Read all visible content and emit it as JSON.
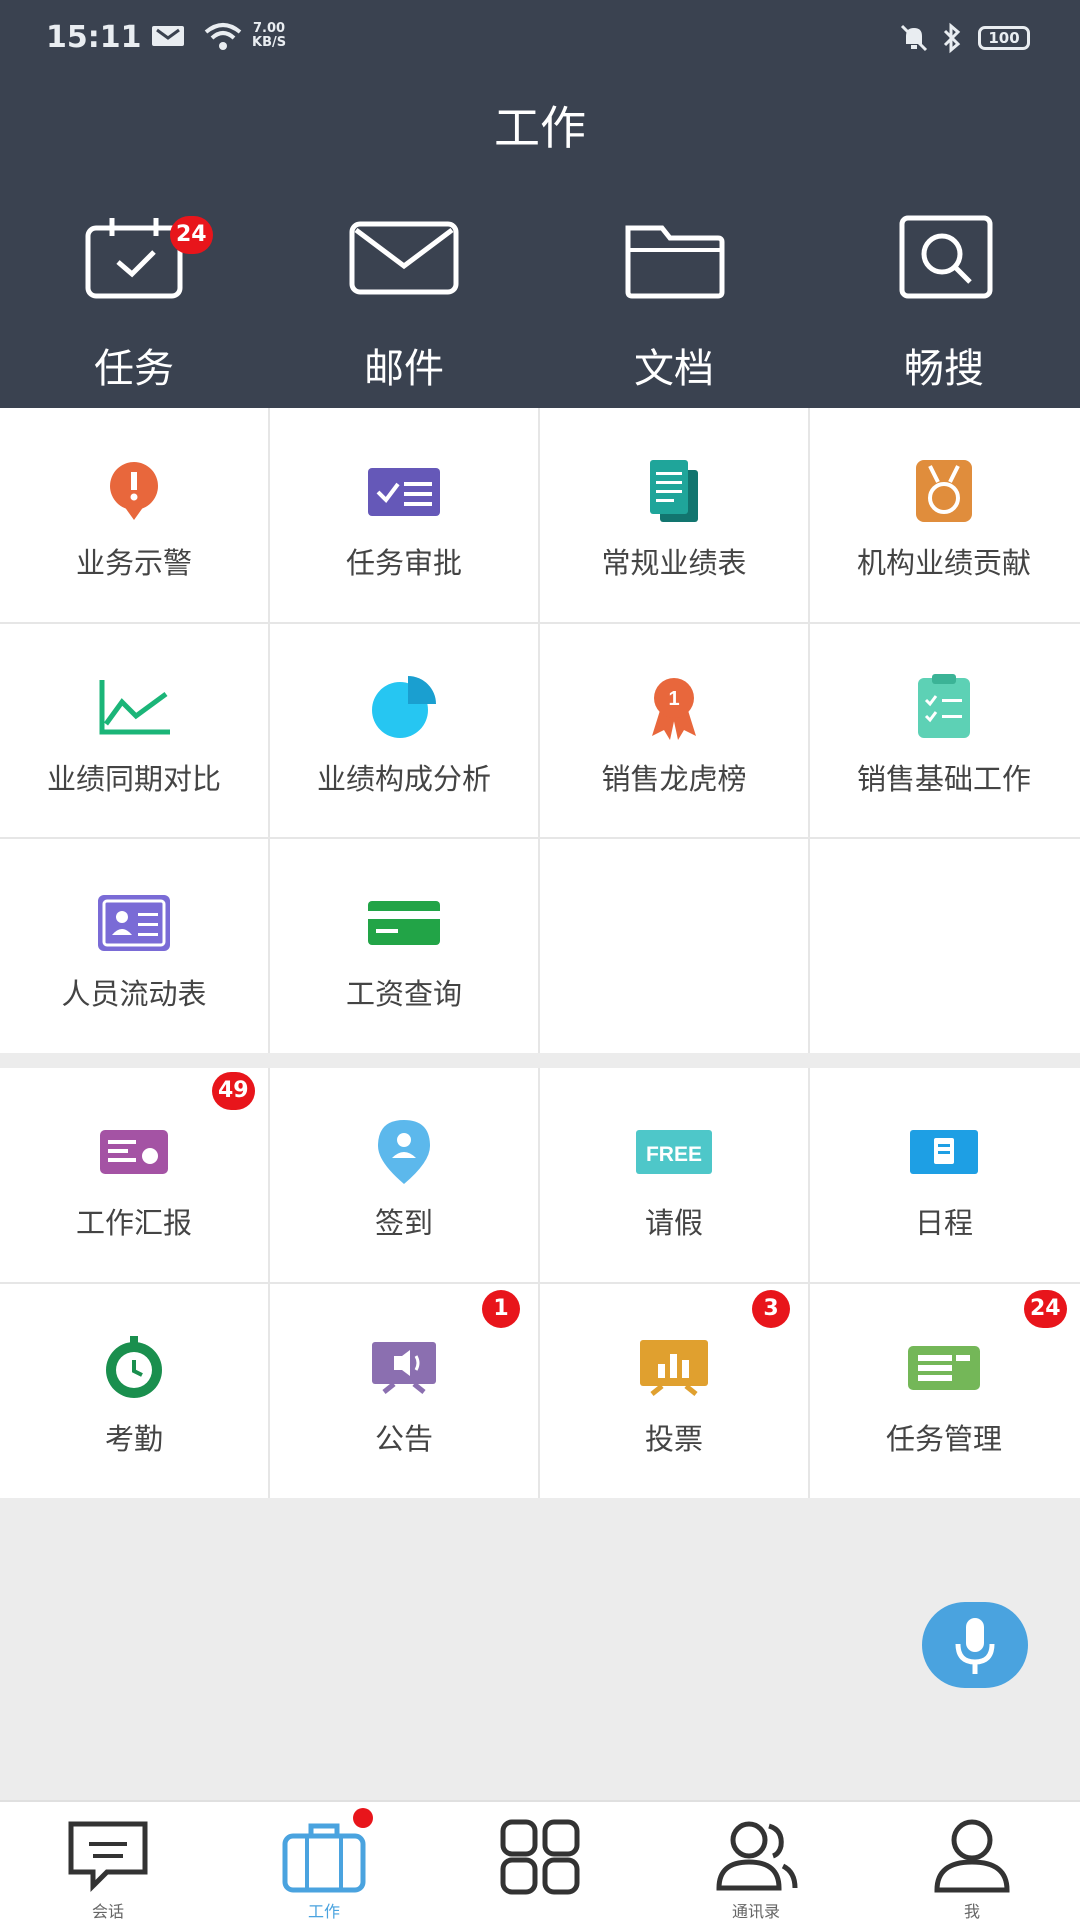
{
  "status_bar": {
    "time": "15:11",
    "net_speed_value": "7.00",
    "net_speed_unit": "KB/S",
    "battery": "100"
  },
  "header": {
    "title": "工作"
  },
  "quick_actions": [
    {
      "label": "任务",
      "icon": "calendar-check-icon",
      "badge": "24"
    },
    {
      "label": "邮件",
      "icon": "envelope-icon"
    },
    {
      "label": "文档",
      "icon": "folder-icon"
    },
    {
      "label": "畅搜",
      "icon": "search-icon"
    }
  ],
  "apps_primary": [
    {
      "label": "业务示警",
      "icon": "alert-pin-icon"
    },
    {
      "label": "任务审批",
      "icon": "checklist-icon"
    },
    {
      "label": "常规业绩表",
      "icon": "document-stack-icon"
    },
    {
      "label": "机构业绩贡献",
      "icon": "medal-icon"
    },
    {
      "label": "业绩同期对比",
      "icon": "line-chart-icon"
    },
    {
      "label": "业绩构成分析",
      "icon": "pie-chart-icon"
    },
    {
      "label": "销售龙虎榜",
      "icon": "ribbon-award-icon"
    },
    {
      "label": "销售基础工作",
      "icon": "clipboard-icon"
    },
    {
      "label": "人员流动表",
      "icon": "id-card-icon"
    },
    {
      "label": "工资查询",
      "icon": "bank-card-icon"
    }
  ],
  "apps_secondary": [
    {
      "label": "工作汇报",
      "icon": "report-icon",
      "badge": "49"
    },
    {
      "label": "签到",
      "icon": "location-pin-icon"
    },
    {
      "label": "请假",
      "icon": "free-tag-icon",
      "icon_text": "FREE"
    },
    {
      "label": "日程",
      "icon": "schedule-icon"
    },
    {
      "label": "考勤",
      "icon": "clock-icon"
    },
    {
      "label": "公告",
      "icon": "announcement-icon",
      "badge": "1"
    },
    {
      "label": "投票",
      "icon": "vote-chart-icon",
      "badge": "3"
    },
    {
      "label": "任务管理",
      "icon": "task-list-icon",
      "badge": "24"
    }
  ],
  "voice_button": {
    "icon": "microphone-icon"
  },
  "tab_bar": [
    {
      "label": "会话",
      "icon": "chat-icon"
    },
    {
      "label": "工作",
      "icon": "briefcase-icon",
      "active": true
    },
    {
      "label": "",
      "icon": "apps-grid-icon"
    },
    {
      "label": "通讯录",
      "icon": "contacts-icon"
    },
    {
      "label": "我",
      "icon": "user-icon"
    }
  ],
  "colors": {
    "header_bg": "#3a4250",
    "badge": "#e8151b",
    "accent": "#4aa3df"
  }
}
